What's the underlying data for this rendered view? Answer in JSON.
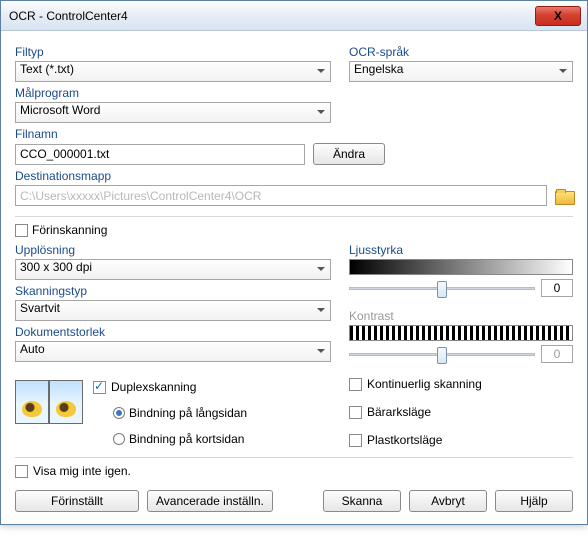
{
  "window": {
    "title": "OCR - ControlCenter4",
    "close": "X"
  },
  "labels": {
    "filetype": "Filtyp",
    "ocrlang": "OCR-språk",
    "targetapp": "Målprogram",
    "filename": "Filnamn",
    "changeBtn": "Ändra",
    "destfolder": "Destinationsmapp",
    "prescan": "Förinskanning",
    "resolution": "Upplösning",
    "scantype": "Skanningstyp",
    "docsize": "Dokumentstorlek",
    "brightness": "Ljusstyrka",
    "contrast": "Kontrast",
    "duplex": "Duplexskanning",
    "bindLong": "Bindning på långsidan",
    "bindShort": "Bindning på kortsidan",
    "contScan": "Kontinuerlig skanning",
    "carrier": "Bärarksläge",
    "plastic": "Plastkortsläge",
    "dontShow": "Visa mig inte igen."
  },
  "values": {
    "filetype": "Text (*.txt)",
    "ocrlang": "Engelska",
    "targetapp": "Microsoft Word",
    "filename": "CCO_000001.txt",
    "destfolder": "C:\\Users\\xxxxx\\Pictures\\ControlCenter4\\OCR",
    "resolution": "300 x 300 dpi",
    "scantype": "Svartvit",
    "docsize": "Auto",
    "brightness": "0",
    "contrast": "0"
  },
  "footer": {
    "preset": "Förinställt",
    "advanced": "Avancerade inställn.",
    "scan": "Skanna",
    "cancel": "Avbryt",
    "help": "Hjälp"
  }
}
